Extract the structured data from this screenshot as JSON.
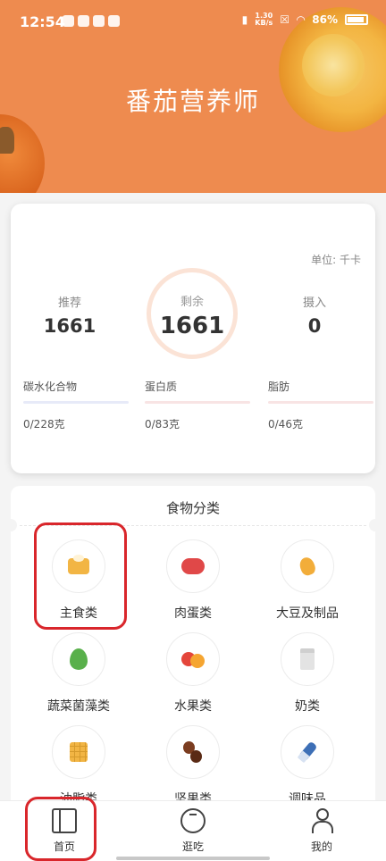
{
  "status_bar": {
    "time": "12:54",
    "net_speed_top": "1.30",
    "net_speed_bottom": "KB/s",
    "battery": "86%"
  },
  "header": {
    "title": "番茄营养师"
  },
  "energy": {
    "unit_label": "单位: 千卡",
    "recommended": {
      "label": "推荐",
      "value": "1661"
    },
    "remaining": {
      "label": "剩余",
      "value": "1661"
    },
    "intake": {
      "label": "摄入",
      "value": "0"
    },
    "macros": [
      {
        "name": "碳水化合物",
        "amount": "0/228克"
      },
      {
        "name": "蛋白质",
        "amount": "0/83克"
      },
      {
        "name": "脂肪",
        "amount": "0/46克"
      }
    ]
  },
  "food_categories": {
    "title": "食物分类",
    "items": [
      {
        "label": "主食类",
        "icon": "staple-food-icon"
      },
      {
        "label": "肉蛋类",
        "icon": "meat-icon"
      },
      {
        "label": "大豆及制品",
        "icon": "soybean-icon"
      },
      {
        "label": "蔬菜菌藻类",
        "icon": "vegetable-icon"
      },
      {
        "label": "水果类",
        "icon": "fruit-icon"
      },
      {
        "label": "奶类",
        "icon": "milk-icon"
      },
      {
        "label": "油脂类",
        "icon": "oil-waffle-icon"
      },
      {
        "label": "坚果类",
        "icon": "nut-icon"
      },
      {
        "label": "调味品",
        "icon": "seasoning-icon"
      }
    ]
  },
  "tabbar": {
    "tabs": [
      {
        "label": "首页",
        "icon": "home-book-icon"
      },
      {
        "label": "逛吃",
        "icon": "tomato-icon"
      },
      {
        "label": "我的",
        "icon": "profile-icon"
      }
    ]
  },
  "colors": {
    "header_bg": "#ee8b4f",
    "highlight": "#d9262b"
  }
}
